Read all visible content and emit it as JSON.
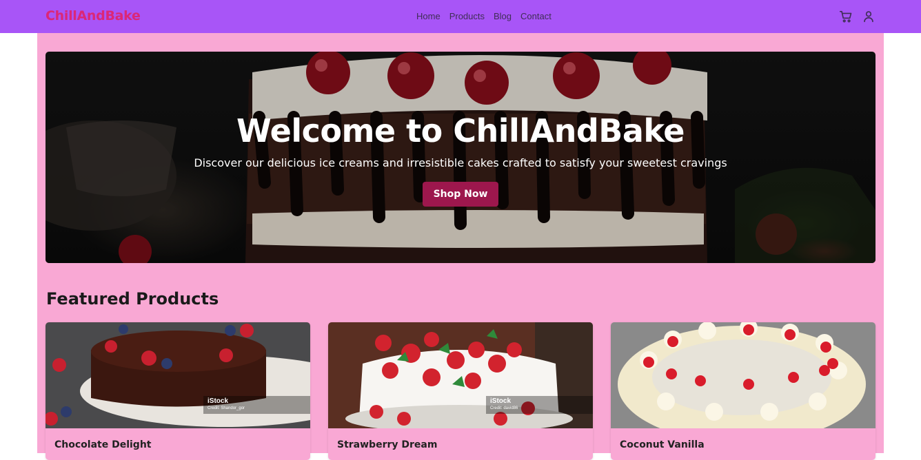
{
  "brand": "ChillAndBake",
  "nav": [
    {
      "label": "Home"
    },
    {
      "label": "Products"
    },
    {
      "label": "Blog"
    },
    {
      "label": "Contact"
    }
  ],
  "icons": {
    "cart": "cart-icon",
    "user": "user-icon"
  },
  "colors": {
    "navbar": "#a855f7",
    "brand": "#db2777",
    "page": "#f9a8d4",
    "button": "#9d174d"
  },
  "hero": {
    "title": "Welcome to ChillAndBake",
    "subtitle": "Discover our delicious ice creams and irresistible cakes crafted to satisfy your sweetest cravings",
    "button": "Shop Now"
  },
  "featured": {
    "title": "Featured Products",
    "products": [
      {
        "name": "Chocolate Delight",
        "watermark": "iStock",
        "credit": "Credit: Shandor_gor"
      },
      {
        "name": "Strawberry Dream",
        "watermark": "iStock",
        "credit": "Credit: david86"
      },
      {
        "name": "Coconut Vanilla"
      }
    ]
  }
}
